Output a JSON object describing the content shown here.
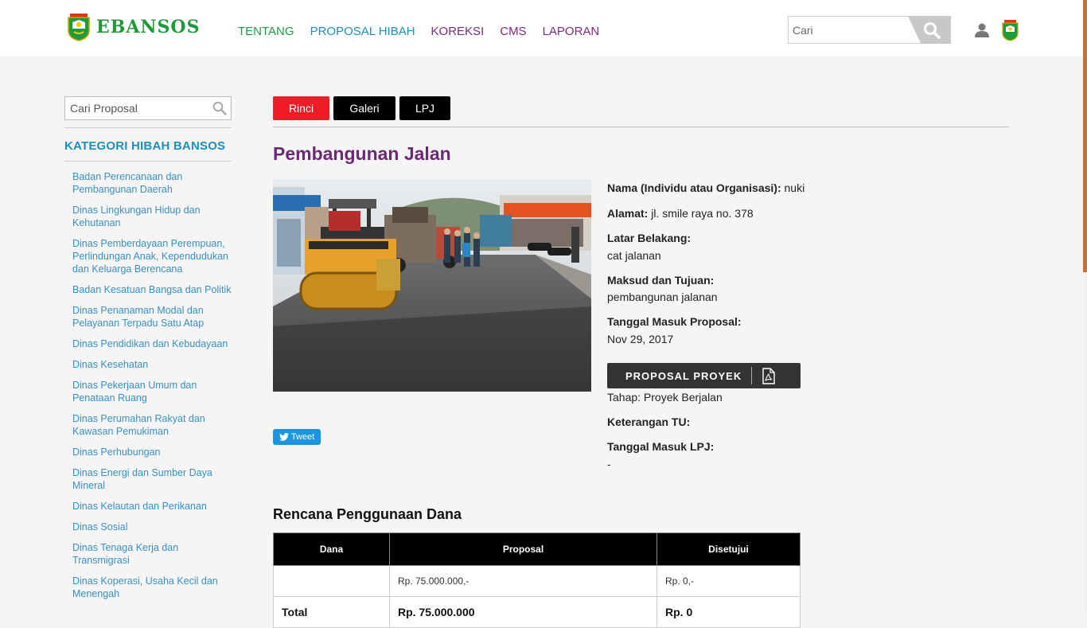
{
  "brand": {
    "name": "EBANSOS",
    "green": "#1f9a3a"
  },
  "nav": {
    "items": [
      {
        "label": "TENTANG"
      },
      {
        "label": "PROPOSAL HIBAH"
      },
      {
        "label": "KOREKSI"
      },
      {
        "label": "CMS"
      },
      {
        "label": "LAPORAN"
      }
    ]
  },
  "header_search": {
    "placeholder": "Cari",
    "icon": "search-icon"
  },
  "sidebar": {
    "search_placeholder": "Cari Proposal",
    "title": "KATEGORI HIBAH BANSOS",
    "items": [
      "Badan Perencanaan dan Pembangunan Daerah",
      "Dinas Lingkungan Hidup dan Kehutanan",
      "Dinas Pemberdayaan Perempuan, Perlindungan Anak, Kependudukan dan Keluarga Berencana",
      "Badan Kesatuan Bangsa dan Politik",
      "Dinas Penanaman Modal dan Pelayanan Terpadu Satu Atap",
      "Dinas Pendidikan dan Kebudayaan",
      "Dinas Kesehatan",
      "Dinas Pekerjaan Umum dan Penataan Ruang",
      "Dinas Perumahan Rakyat dan Kawasan Pemukiman",
      "Dinas Perhubungan",
      "Dinas Energi dan Sumber Daya Mineral",
      "Dinas Kelautan dan Perikanan",
      "Dinas Sosial",
      "Dinas Tenaga Kerja dan Transmigrasi",
      "Dinas Koperasi, Usaha Kecil dan Menengah"
    ]
  },
  "tabs": {
    "rinci": "Rinci",
    "galeri": "Galeri",
    "lpj": "LPJ"
  },
  "proposal": {
    "title": "Pembangunan Jalan",
    "tweet_label": "Tweet",
    "nama_label": "Nama (Individu atau Organisasi):",
    "nama_value": "nuki",
    "alamat_label": "Alamat:",
    "alamat_value": "jl. smile raya no. 378",
    "latar_label": "Latar Belakang:",
    "latar_value": "cat jalanan",
    "maksud_label": "Maksud dan Tujuan:",
    "maksud_value": "pembangunan jalanan",
    "tanggal_label": "Tanggal Masuk Proposal:",
    "tanggal_value": "Nov 29, 2017",
    "pdf_button": "PROPOSAL PROYEK",
    "tahap": "Tahap: Proyek Berjalan",
    "keterangan_label": "Keterangan TU:",
    "lpj_label": "Tanggal Masuk LPJ:",
    "lpj_value": "-"
  },
  "funds": {
    "title": "Rencana Penggunaan Dana",
    "headers": [
      "Dana",
      "Proposal",
      "Disetujui"
    ],
    "rows": [
      {
        "dana": "",
        "proposal": "Rp. 75.000.000,-",
        "disetujui": "Rp. 0,-"
      }
    ],
    "total": {
      "label": "Total",
      "proposal": "Rp. 75.000.000",
      "disetujui": "Rp. 0"
    }
  }
}
